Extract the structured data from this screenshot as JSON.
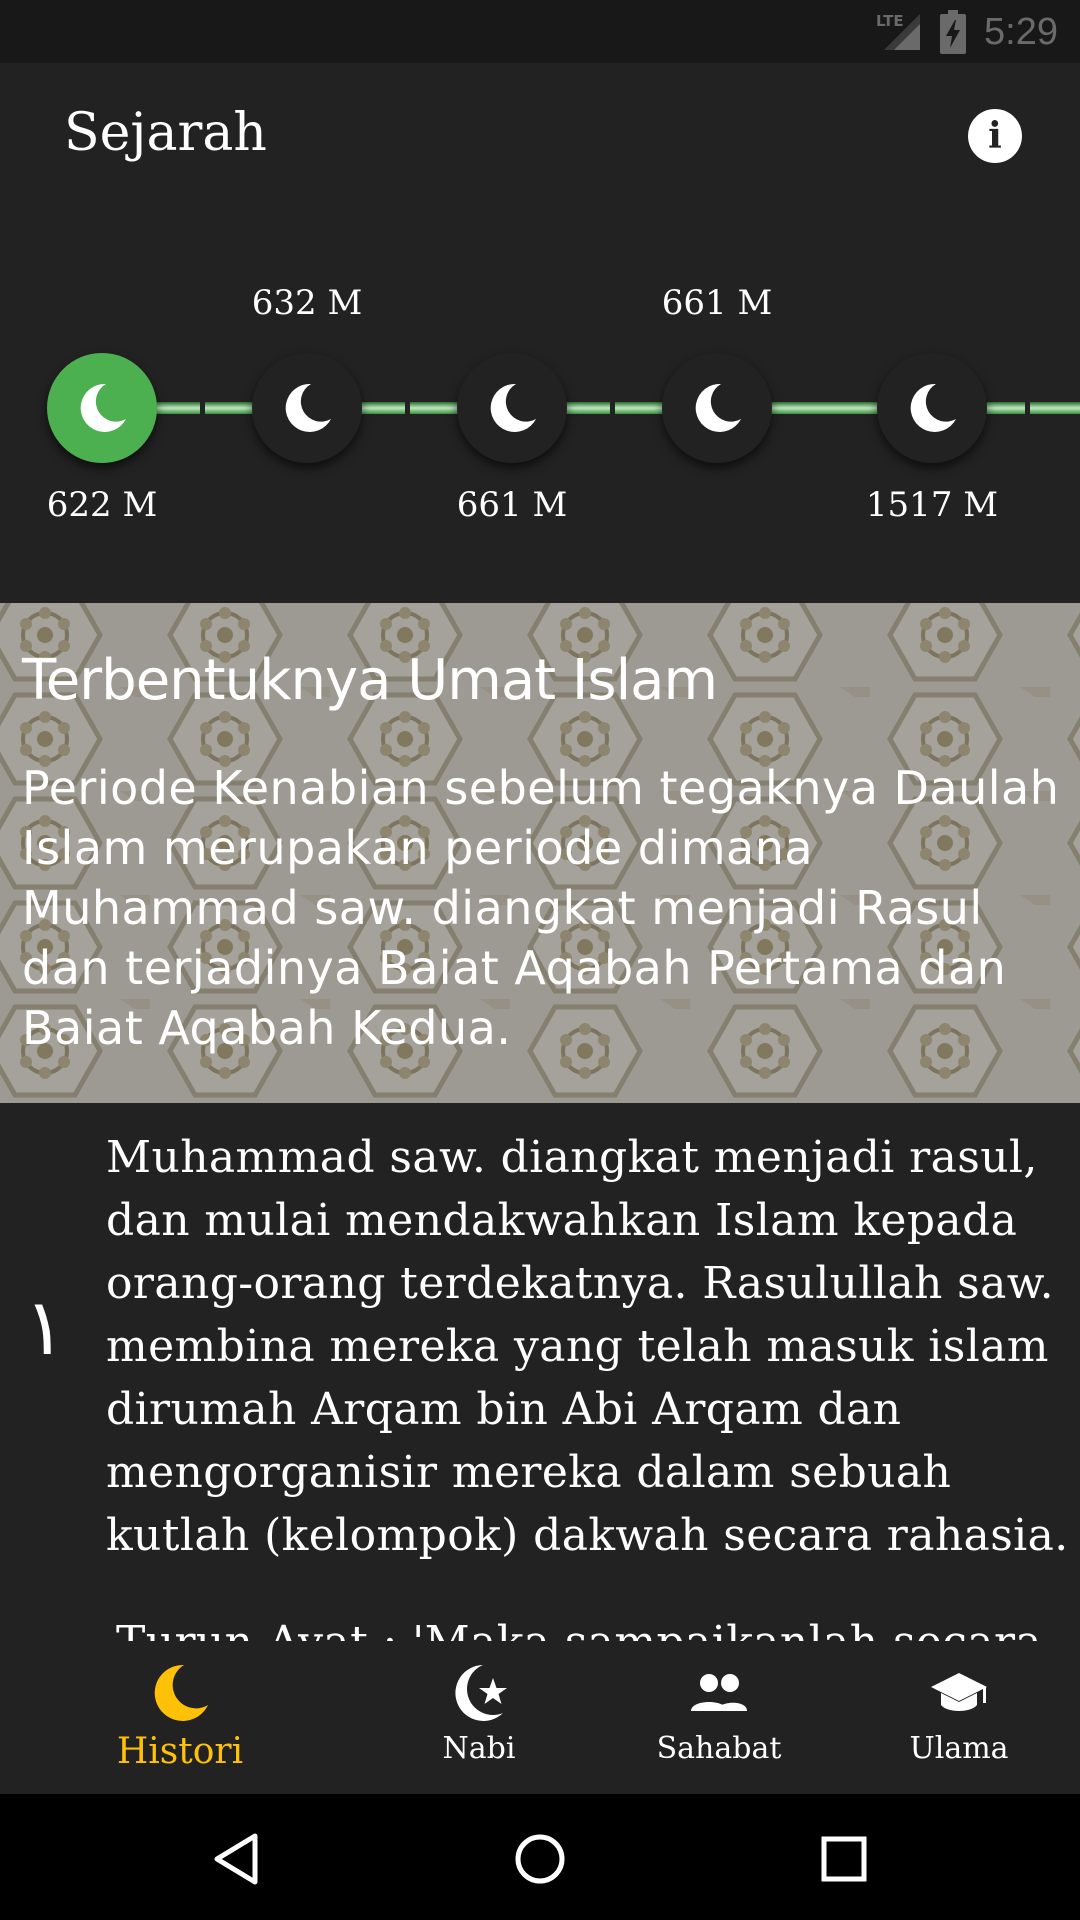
{
  "status_bar": {
    "network": "LTE",
    "time": "5:29"
  },
  "app_bar": {
    "title": "Sejarah",
    "info_icon": "info-icon"
  },
  "timeline": {
    "accent_color": "#4caf50",
    "nodes": [
      {
        "year": "622 M",
        "label_position": "below",
        "active": true
      },
      {
        "year": "632 M",
        "label_position": "above",
        "active": false
      },
      {
        "year": "661 M",
        "label_position": "below",
        "active": false
      },
      {
        "year": "661 M",
        "label_position": "above",
        "active": false
      },
      {
        "year": "1517 M",
        "label_position": "below",
        "active": false
      }
    ]
  },
  "banner": {
    "title": "Terbentuknya Umat Islam",
    "description": "Periode Kenabian sebelum tegaknya Daulah Islam merupakan periode dimana Muhammad saw. diangkat menjadi Rasul dan terjadinya Baiat Aqabah Pertama dan Baiat Aqabah Kedua."
  },
  "content": {
    "numeral": "١",
    "paragraph": "Muhammad saw. diangkat menjadi rasul, dan mulai mendakwahkan Islam kepada orang-orang terdekatnya. Rasulullah saw. membina mereka yang telah masuk islam dirumah Arqam bin Abi Arqam dan mengorganisir mereka dalam sebuah kutlah (kelompok) dakwah secara rahasia.",
    "next_line": "Turun Ayat : 'Maka sampaikanlah secara"
  },
  "bottom_nav": {
    "active_color": "#ffc107",
    "items": [
      {
        "label": "Histori",
        "icon": "moon-icon",
        "active": true
      },
      {
        "label": "Nabi",
        "icon": "crescent-star-icon",
        "active": false
      },
      {
        "label": "Sahabat",
        "icon": "people-icon",
        "active": false
      },
      {
        "label": "Ulama",
        "icon": "graduation-cap-icon",
        "active": false
      }
    ]
  },
  "system_nav": {
    "back_icon": "back-icon",
    "home_icon": "home-icon",
    "recents_icon": "recents-icon"
  }
}
